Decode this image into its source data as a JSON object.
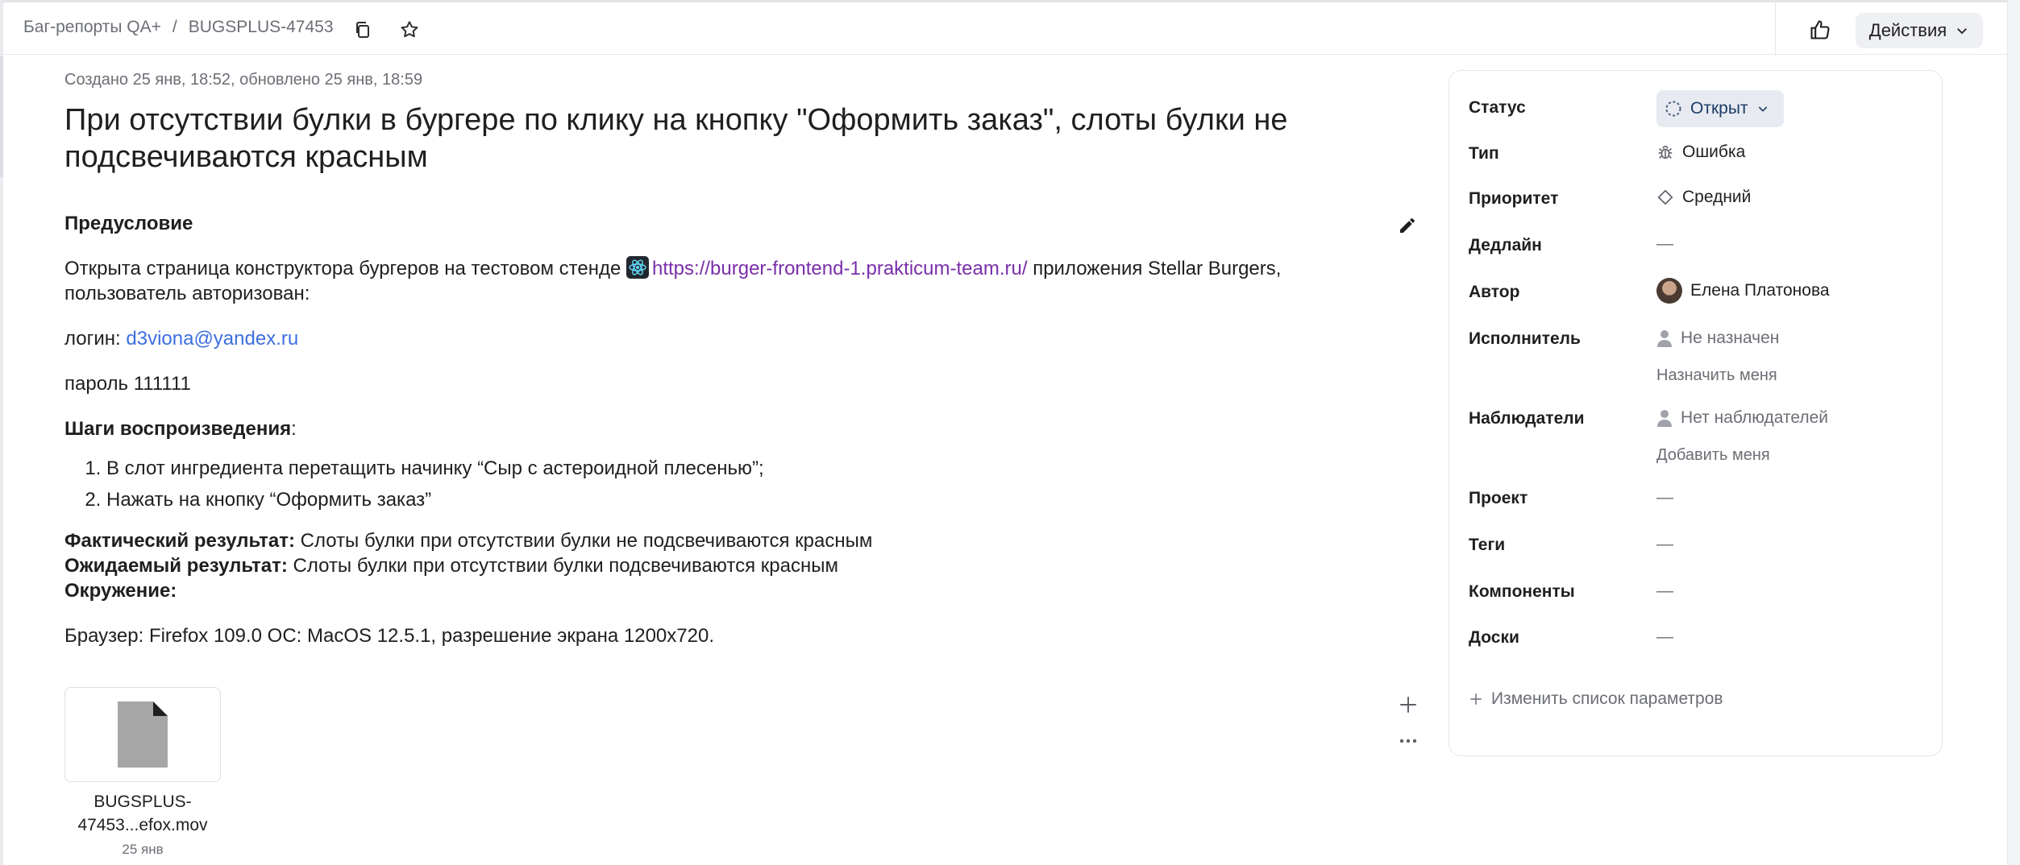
{
  "breadcrumb": {
    "queue": "Баг-репорты QA+",
    "separator": "/",
    "issue_key": "BUGSPLUS-47453"
  },
  "toolbar": {
    "actions_label": "Действия",
    "icons": [
      "copy-icon",
      "star-icon",
      "thumbs-up-icon",
      "chevron-down-icon"
    ]
  },
  "issue": {
    "meta": "Создано 25 янв, 18:52, обновлено 25 янв, 18:59",
    "title": "При отсутствии булки в бургере по клику на кнопку \"Оформить заказ\", слоты булки не подсвечиваются красным"
  },
  "description": {
    "precondition_heading": "Предусловие",
    "precondition_text_before": "Открыта страница конструктора бургеров на тестовом стенде",
    "precondition_link": "https://burger-frontend-1.prakticum-team.ru/",
    "precondition_text_after": "приложения Stellar Burgers, пользователь авторизован:",
    "login_label": "логин:",
    "login_value": "d3viona@yandex.ru",
    "password_line": "пароль 111111",
    "steps_heading": "Шаги воспроизведения",
    "steps_colon": ":",
    "steps": [
      "В слот ингредиента перетащить начинку “Сыр с астероидной плесенью”;",
      "Нажать на кнопку “Оформить заказ”"
    ],
    "actual_label": "Фактический результат:",
    "actual_text": "Слоты булки при отсутствии булки не подсвечиваются красным",
    "expected_label": "Ожидаемый результат:",
    "expected_text": "Слоты булки при отсутствии булки подсвечиваются красным",
    "environment_label": "Окружение:",
    "environment_text": "Браузер: Firefox 109.0 ОС: MacOS 12.5.1, разрешение экрана 1200х720."
  },
  "attachment": {
    "name_line1": "BUGSPLUS-",
    "name_line2": "47453...efox.mov",
    "date": "25 янв"
  },
  "fields": {
    "status_label": "Статус",
    "status_value": "Открыт",
    "type_label": "Тип",
    "type_value": "Ошибка",
    "priority_label": "Приоритет",
    "priority_value": "Средний",
    "deadline_label": "Дедлайн",
    "deadline_value": "—",
    "author_label": "Автор",
    "author_value": "Елена Платонова",
    "assignee_label": "Исполнитель",
    "assignee_value": "Не назначен",
    "assign_me": "Назначить меня",
    "followers_label": "Наблюдатели",
    "followers_value": "Нет наблюдателей",
    "add_me": "Добавить меня",
    "project_label": "Проект",
    "project_value": "—",
    "tags_label": "Теги",
    "tags_value": "—",
    "components_label": "Компоненты",
    "components_value": "—",
    "boards_label": "Доски",
    "boards_value": "—",
    "change_params": "Изменить список параметров"
  },
  "colors": {
    "link_purple": "#7a2eaa",
    "link_blue": "#3e6fe0",
    "status_bg": "#e7ebf1",
    "muted": "#6b6e75"
  }
}
